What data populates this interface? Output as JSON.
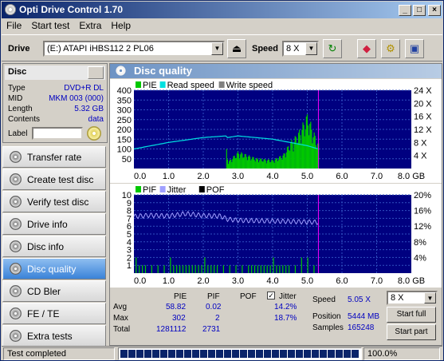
{
  "window": {
    "title": "Opti Drive Control 1.70",
    "min": "_",
    "max": "□",
    "close": "×"
  },
  "menu": [
    "File",
    "Start test",
    "Extra",
    "Help"
  ],
  "toolbar": {
    "drive_label": "Drive",
    "drive_value": "(E:)   ATAPI iHBS112   2 PL06",
    "speed_label": "Speed",
    "speed_value": "8 X"
  },
  "disc": {
    "header": "Disc",
    "rows": [
      {
        "k": "Type",
        "v": "DVD+R DL"
      },
      {
        "k": "MID",
        "v": "MKM 003 (000)"
      },
      {
        "k": "Length",
        "v": "5.32 GB"
      },
      {
        "k": "Contents",
        "v": "data"
      }
    ],
    "label_key": "Label"
  },
  "nav": [
    {
      "label": "Transfer rate",
      "active": false
    },
    {
      "label": "Create test disc",
      "active": false
    },
    {
      "label": "Verify test disc",
      "active": false
    },
    {
      "label": "Drive info",
      "active": false
    },
    {
      "label": "Disc info",
      "active": false
    },
    {
      "label": "Disc quality",
      "active": true
    },
    {
      "label": "CD Bler",
      "active": false
    },
    {
      "label": "FE / TE",
      "active": false
    },
    {
      "label": "Extra tests",
      "active": false
    }
  ],
  "main": {
    "title": "Disc quality"
  },
  "chart_data": [
    {
      "type": "bar",
      "legend": [
        "PIE",
        "Read speed",
        "Write speed"
      ],
      "xlim": [
        0,
        8.0
      ],
      "ylim": [
        0,
        400
      ],
      "y2lim": [
        0,
        24
      ],
      "x_ticks": [
        "0.0",
        "1.0",
        "2.0",
        "3.0",
        "4.0",
        "5.0",
        "6.0",
        "7.0",
        "8.0 GB"
      ],
      "y_ticks": [
        "400",
        "350",
        "300",
        "250",
        "200",
        "150",
        "100",
        "50"
      ],
      "y2_ticks": [
        "24 X",
        "20 X",
        "16 X",
        "12 X",
        "8 X",
        "4 X"
      ],
      "pie_x": [
        0,
        0.5,
        1.0,
        1.5,
        2.0,
        2.5,
        2.65,
        2.7,
        3.0,
        3.5,
        4.0,
        4.3,
        4.5,
        4.7,
        4.9,
        5.0,
        5.1,
        5.2,
        5.3
      ],
      "pie_y": [
        90,
        85,
        75,
        70,
        70,
        75,
        120,
        35,
        90,
        55,
        45,
        75,
        140,
        180,
        250,
        290,
        230,
        180,
        130
      ],
      "read_speed_x": [
        0,
        1,
        2,
        2.65,
        2.7,
        3,
        4,
        5,
        5.32
      ],
      "read_speed_y": [
        6,
        8,
        9.5,
        10,
        9.5,
        10,
        9,
        7,
        6
      ]
    },
    {
      "type": "bar",
      "legend": [
        "PIF",
        "Jitter",
        "POF"
      ],
      "xlim": [
        0,
        8.0
      ],
      "ylim": [
        0,
        10
      ],
      "y2lim": [
        0,
        20
      ],
      "x_ticks": [
        "0.0",
        "1.0",
        "2.0",
        "3.0",
        "4.0",
        "5.0",
        "6.0",
        "7.0",
        "8.0 GB"
      ],
      "y_ticks": [
        "10",
        "9",
        "8",
        "7",
        "6",
        "5",
        "4",
        "3",
        "2",
        "1"
      ],
      "y2_ticks": [
        "20%",
        "16%",
        "12%",
        "8%",
        "4%"
      ],
      "jitter_x": [
        0,
        0.5,
        1,
        1.5,
        2,
        2.5,
        2.7,
        3,
        4,
        5,
        5.32
      ],
      "jitter_y": [
        14.5,
        14.8,
        14.6,
        15.2,
        14.7,
        14.6,
        13.8,
        13.5,
        13.3,
        13.1,
        13.0
      ]
    }
  ],
  "stats": {
    "h_pie": "PIE",
    "h_pif": "PIF",
    "h_pof": "POF",
    "h_jitter": "Jitter",
    "avg_label": "Avg",
    "avg_pie": "58.82",
    "avg_pif": "0.02",
    "avg_jitter": "14.2%",
    "max_label": "Max",
    "max_pie": "302",
    "max_pif": "2",
    "max_jitter": "18.7%",
    "total_label": "Total",
    "total_pie": "1281112",
    "total_pif": "2731",
    "speed_label": "Speed",
    "speed_value": "5.05 X",
    "speed_sel": "8 X",
    "position_label": "Position",
    "position_value": "5444 MB",
    "samples_label": "Samples",
    "samples_value": "165248",
    "start_full": "Start full",
    "start_part": "Start part"
  },
  "status": {
    "text": "Test completed",
    "progress": 1.0,
    "pct": "100.0%"
  },
  "colors": {
    "pie": "#00c800",
    "read": "#00e0e0",
    "pif": "#00c800",
    "jitter": "#a0a0ff",
    "plot_bg": "#000080"
  }
}
